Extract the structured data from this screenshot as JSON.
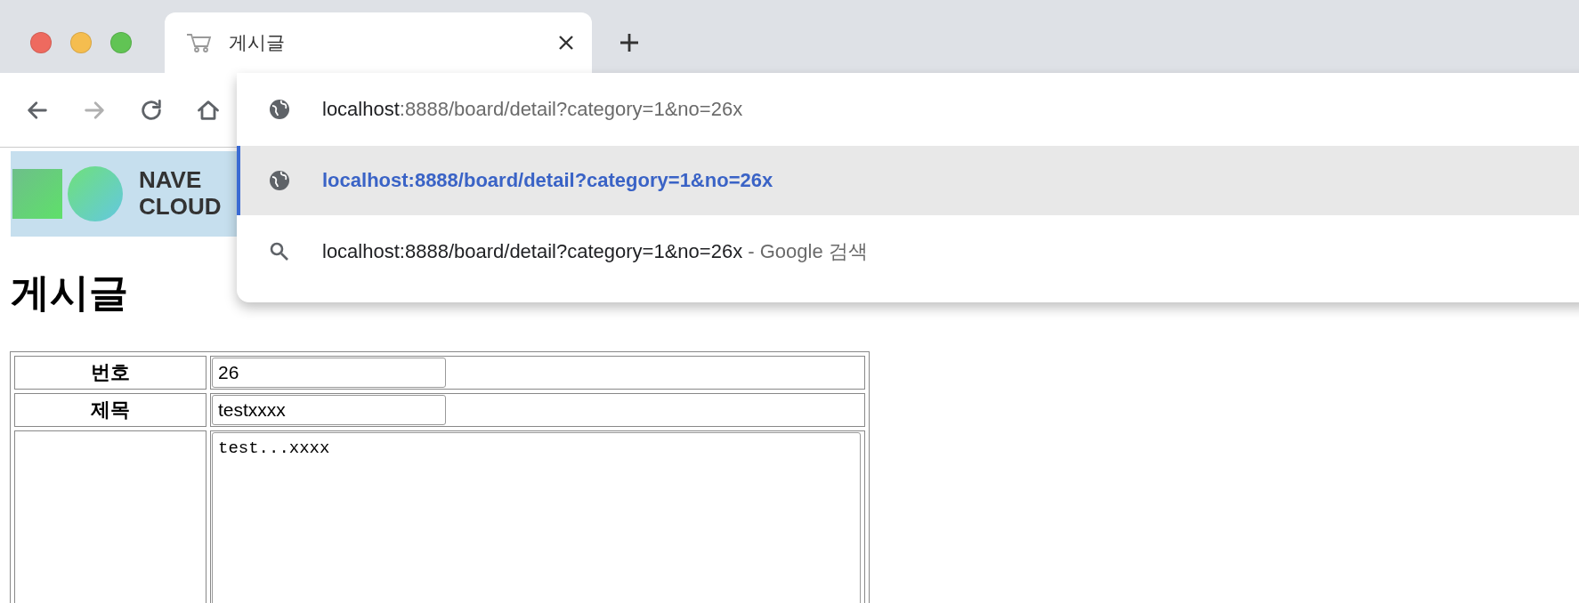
{
  "tab": {
    "title": "게시글"
  },
  "suggestions": [
    {
      "kind": "url",
      "selected": false,
      "primary": "localhost",
      "secondary": ":8888/board/detail?category=1&no=26x"
    },
    {
      "kind": "url",
      "selected": true,
      "primary": "localhost:8888/board/detail?category=1&no=26x"
    },
    {
      "kind": "search",
      "selected": false,
      "primary": "localhost:8888/board/detail?category=1&no=26x",
      "secondary": " - Google 검색"
    }
  ],
  "logo": {
    "lines": [
      "NAVE",
      "CLOUD"
    ]
  },
  "heading": "게시글",
  "form": {
    "rows": [
      {
        "kind": "input",
        "label": "번호",
        "value": "26"
      },
      {
        "kind": "input",
        "label": "제목",
        "value": "testxxxx"
      },
      {
        "kind": "textarea",
        "value": "test...xxxx"
      }
    ]
  }
}
